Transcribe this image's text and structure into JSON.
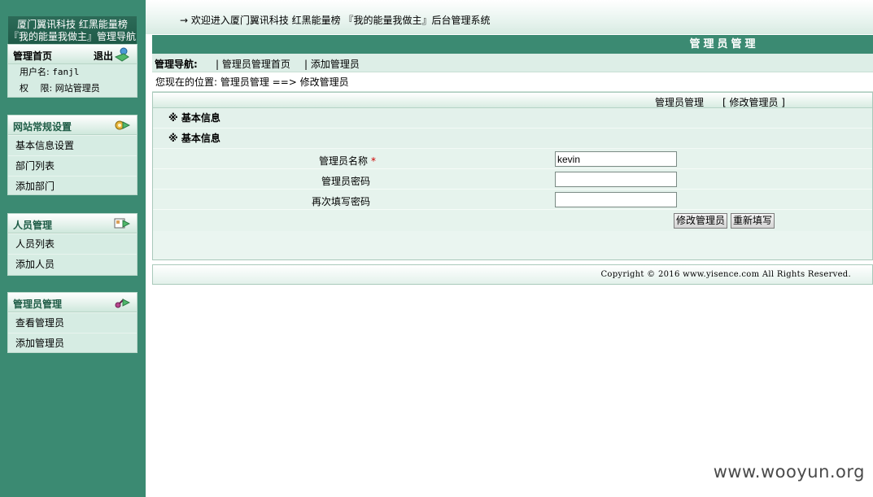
{
  "sidebar": {
    "title_line1": "厦门翼讯科技 红黑能量榜",
    "title_line2": "『我的能量我做主』管理导航",
    "home_panel": {
      "label": "管理首页",
      "logout": "退出",
      "username_label": "用户名:",
      "username_value": "fanjl",
      "permission_label": "权　 限:",
      "permission_value": "网站管理员"
    },
    "site_panel": {
      "label": "网站常规设置",
      "items": [
        "基本信息设置",
        "部门列表",
        "添加部门"
      ]
    },
    "people_panel": {
      "label": "人员管理",
      "items": [
        "人员列表",
        "添加人员"
      ]
    },
    "admin_panel": {
      "label": "管理员管理",
      "items": [
        "查看管理员",
        "添加管理员"
      ]
    }
  },
  "header": {
    "welcome": "→ 欢迎进入厦门翼讯科技 红黑能量榜 『我的能量我做主』后台管理系统"
  },
  "main": {
    "title": "管理员管理",
    "nav_label": "管理导航:",
    "nav_links": [
      "| 管理员管理首页",
      "| 添加管理员"
    ],
    "location": "您现在的位置: 管理员管理 ==> 修改管理员",
    "content_bar_link1": "管理员管理",
    "content_bar_link2": "[ 修改管理员 ]",
    "section1": "※ 基本信息",
    "section2": "※ 基本信息",
    "form": {
      "name_label": "管理员名称",
      "required_mark": "*",
      "name_value": "kevin",
      "password_label": "管理员密码",
      "password_value": "",
      "confirm_label": "再次填写密码",
      "confirm_value": ""
    },
    "buttons": {
      "submit": "修改管理员",
      "reset": "重新填写"
    },
    "footer": "Copyright © 2016 www.yisence.com All Rights Reserved."
  },
  "watermark": "www.wooyun.org",
  "colors": {
    "sidebar_bg": "#3b8a72",
    "title_bar_bg": "#3b8a72",
    "panel_bg": "#d6ece3",
    "required": "#cc0000"
  },
  "icons": {
    "logout": "user-exit-icon",
    "site_settings": "gear-icon",
    "people": "people-card-icon",
    "admin": "key-icon"
  }
}
